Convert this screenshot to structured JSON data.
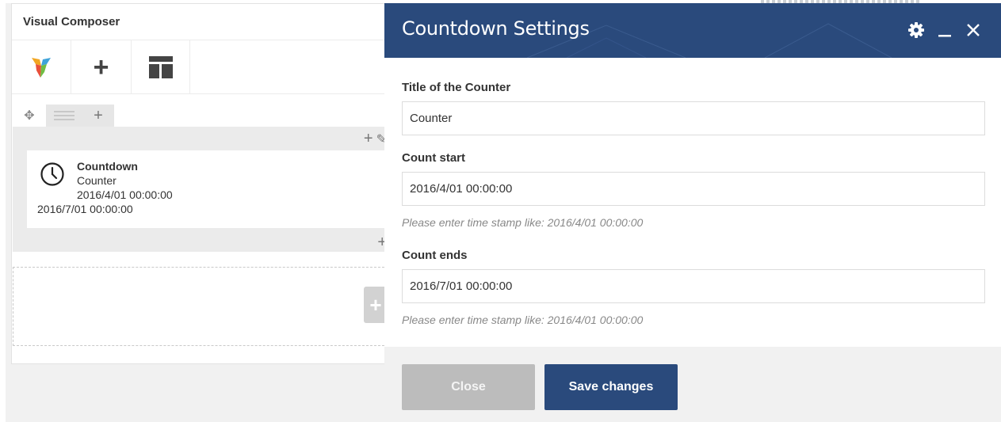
{
  "composer": {
    "title": "Visual Composer",
    "toolbar": {
      "logo_icon": "vc-logo-icon",
      "add_icon": "plus-icon",
      "templates_icon": "layout-icon"
    },
    "row_controls": {
      "move_icon": "move-icon",
      "layout_icon": "row-layout-icon",
      "add_icon": "plus-icon"
    },
    "element": {
      "icon": "clock-icon",
      "name": "Countdown",
      "line1": "Counter",
      "line2": "2016/4/01 00:00:00",
      "line3": "2016/7/01 00:00:00"
    }
  },
  "modal": {
    "title": "Countdown Settings",
    "header_icons": [
      "gear-icon",
      "minimize-icon",
      "close-icon"
    ],
    "fields": [
      {
        "label": "Title of the Counter",
        "value": "Counter"
      },
      {
        "label": "Count start",
        "value": "2016/4/01 00:00:00",
        "help": "Please enter time stamp like: 2016/4/01 00:00:00"
      },
      {
        "label": "Count ends",
        "value": "2016/7/01 00:00:00",
        "help": "Please enter time stamp like: 2016/4/01 00:00:00"
      }
    ],
    "buttons": {
      "close": "Close",
      "save": "Save changes"
    }
  },
  "colors": {
    "header_bg": "#2a4a7c",
    "save_bg": "#2a4a7c",
    "close_bg": "#bcbcbc",
    "footer_bg": "#f1f1f1"
  }
}
